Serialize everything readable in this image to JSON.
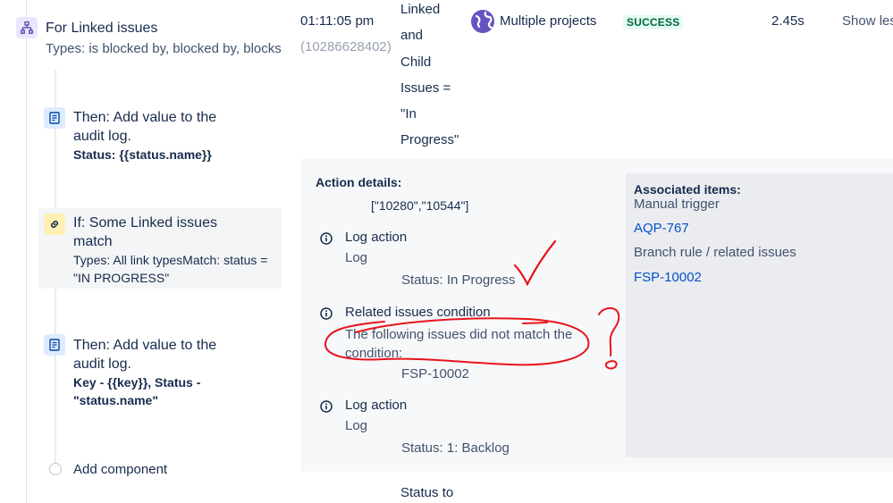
{
  "rule": {
    "branch": {
      "title": "For Linked issues",
      "subtitle": "Types: is blocked by, blocked by, blocks"
    },
    "action1": {
      "title_line1": "Then: Add value to the",
      "title_line2": "audit log.",
      "value": "Status: {{status.name}}"
    },
    "condition": {
      "title_line1": "If: Some Linked issues",
      "title_line2": "match",
      "desc_line1": "Types: All link typesMatch: status =",
      "desc_line2": "\"IN PROGRESS\""
    },
    "action2": {
      "title_line1": "Then: Add value to the",
      "title_line2": "audit log.",
      "value_line1": "Key - {{key}}, Status -",
      "value_line2": "\"status.name\""
    },
    "add_component": "Add component"
  },
  "log_row": {
    "time": "01:11:05 pm",
    "id": "(10286628402)",
    "desc_lines": [
      "Linked",
      "and",
      "Child",
      "Issues =",
      "\"In",
      "Progress\""
    ],
    "project": "Multiple projects",
    "status": "SUCCESS",
    "duration": "2.45s",
    "toggle": "Show les"
  },
  "details": {
    "heading": "Action details:",
    "ids": "[\"10280\",\"10544\"]",
    "entries": [
      {
        "title": "Log action",
        "sub": "Log",
        "value": "Status: In Progress"
      },
      {
        "title": "Related issues condition",
        "sub_line1": "The following issues did not match the",
        "sub_line2": "condition:",
        "value": "FSP-10002"
      },
      {
        "title": "Log action",
        "sub": "Log",
        "value": "Status: 1: Backlog"
      }
    ],
    "trailing": "Status to"
  },
  "associated": {
    "heading": "Associated items:",
    "trigger": "Manual trigger",
    "trigger_link": "AQP-767",
    "branch": "Branch rule / related issues",
    "branch_link": "FSP-10002"
  },
  "colors": {
    "badge_bg": "#e3fcef",
    "badge_fg": "#006644",
    "link": "#0052cc",
    "annotation": "#e8141e"
  }
}
